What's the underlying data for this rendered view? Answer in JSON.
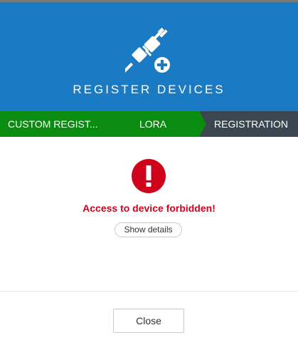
{
  "header": {
    "title": "REGISTER DEVICES",
    "icon": "plug-add-icon",
    "background": "#1a7ac4"
  },
  "steps": [
    {
      "label": "CUSTOM REGIST...",
      "state": "completed",
      "color": "#0a8c10"
    },
    {
      "label": "LORA",
      "state": "completed",
      "color": "#0a8c10"
    },
    {
      "label": "REGISTRATION",
      "state": "current",
      "color": "#3c4650"
    }
  ],
  "error": {
    "icon": "exclamation-circle-icon",
    "color": "#d0021b",
    "message": "Access to device forbidden!",
    "details_label": "Show details"
  },
  "footer": {
    "close_label": "Close"
  }
}
